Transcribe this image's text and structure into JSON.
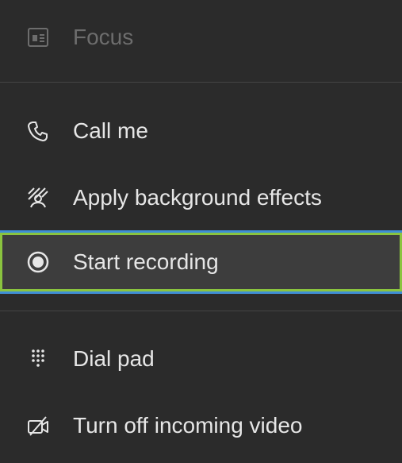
{
  "menu": {
    "items": [
      {
        "label": "Focus",
        "icon": "focus-icon",
        "state": "disabled"
      },
      {
        "label": "Call me",
        "icon": "phone-icon"
      },
      {
        "label": "Apply background effects",
        "icon": "background-effects-icon"
      },
      {
        "label": "Start recording",
        "icon": "record-icon",
        "state": "focused"
      },
      {
        "label": "Dial pad",
        "icon": "dial-pad-icon"
      },
      {
        "label": "Turn off incoming video",
        "icon": "video-off-icon"
      }
    ]
  },
  "colors": {
    "background": "#2b2b2b",
    "text": "#e6e6e6",
    "disabled_text": "#6d6d6d",
    "focus_border_outer": "#3f8fd6",
    "focus_border_inner": "#8ac43f",
    "focused_background": "#3d3d3d"
  }
}
